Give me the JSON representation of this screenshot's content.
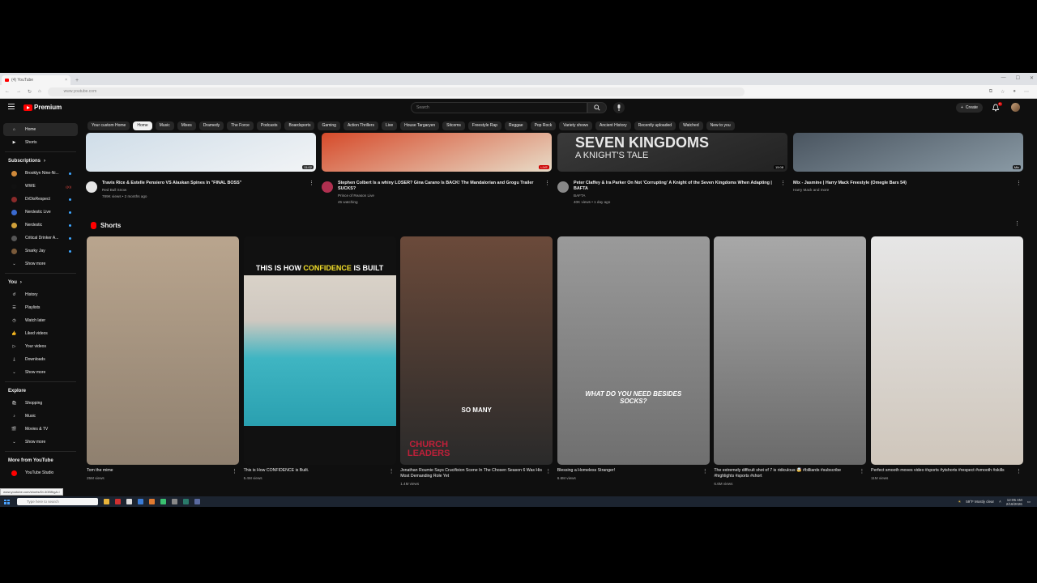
{
  "browser": {
    "tab_title": "(4) YouTube",
    "url": "www.youtube.com",
    "status_url": "www.youtube.com/shorts/DI-3OBfhgA-I"
  },
  "masthead": {
    "logo_text": "Premium",
    "search_placeholder": "Search",
    "create_label": "Create",
    "notification_count": "9+"
  },
  "chips": [
    "Your custom Home",
    "Home",
    "Music",
    "Mixes",
    "Dramedy",
    "The Force",
    "Podcasts",
    "Boardsports",
    "Gaming",
    "Action Thrillers",
    "Live",
    "House Targaryen",
    "Sitcoms",
    "Freestyle Rap",
    "Reggae",
    "Pop Rock",
    "Variety shows",
    "Ancient History",
    "Recently uploaded",
    "Watched",
    "New to you"
  ],
  "sidebar": {
    "main": [
      {
        "label": "Home",
        "icon": "home-icon"
      },
      {
        "label": "Shorts",
        "icon": "shorts-icon"
      }
    ],
    "subscriptions_title": "Subscriptions",
    "subscriptions": [
      {
        "label": "Brooklyn Nine-Ni...",
        "color": "#d08a3a"
      },
      {
        "label": "WWE",
        "color": "#111111"
      },
      {
        "label": "DrDisRespect",
        "color": "#8a2a2a"
      },
      {
        "label": "Nerdestic Live",
        "color": "#3a6ad0"
      },
      {
        "label": "Nerdestic",
        "color": "#d0a03a"
      },
      {
        "label": "Critical Drinker A...",
        "color": "#555555"
      },
      {
        "label": "Snarky Jay",
        "color": "#7a5a3a"
      }
    ],
    "show_more": "Show more",
    "you_title": "You",
    "you_items": [
      {
        "label": "History",
        "icon": "history-icon"
      },
      {
        "label": "Playlists",
        "icon": "playlists-icon"
      },
      {
        "label": "Watch later",
        "icon": "watch-later-icon"
      },
      {
        "label": "Liked videos",
        "icon": "liked-icon"
      },
      {
        "label": "Your videos",
        "icon": "your-videos-icon"
      },
      {
        "label": "Downloads",
        "icon": "downloads-icon"
      }
    ],
    "explore_title": "Explore",
    "explore_items": [
      {
        "label": "Shopping",
        "icon": "shopping-icon"
      },
      {
        "label": "Music",
        "icon": "music-icon"
      },
      {
        "label": "Movies & TV",
        "icon": "movies-icon"
      }
    ],
    "more_title": "More from YouTube",
    "studio_label": "YouTube Studio"
  },
  "videos": [
    {
      "title": "Travis Rice & Estelle Pensiero VS Alaskan Spines In \"FINAL BOSS\"",
      "channel": "Red Bull Snow",
      "meta": "789K views • 2 months ago",
      "duration": "11:02",
      "thumb_a": "#cfdde8",
      "thumb_b": "#f2f4f6",
      "avatar": "#e6e6e6"
    },
    {
      "title": "Stephen Colbert Is a whiny LOSER? Gina Carano Is BACK! The Mandalorian and Grogu Trailer SUCKS?",
      "channel": "Prince of Reason Live",
      "meta": "45 watching",
      "duration": "LIVE",
      "thumb_a": "#d64a2a",
      "thumb_b": "#e8dcc8",
      "avatar": "#b03050"
    },
    {
      "title": "Peter Claffey & Ira Parker On Not 'Corrupting' A Knight of the Seven Kingdoms When Adapting | BAFTA",
      "channel": "BAFTA",
      "meta": "40K views • 1 day ago",
      "duration": "15:08",
      "thumb_a": "#3a3a3a",
      "thumb_b": "#222222",
      "avatar": "#888888",
      "overlay1": "SEVEN KINGDOMS",
      "overlay2": "A KNIGHT'S TALE"
    },
    {
      "title": "Mix - Jasmine | Harry Mack Freestyle (Omegle Bars 54)",
      "channel": "Harry Mack and more",
      "meta": "",
      "duration": "Mix",
      "thumb_a": "#4a5560",
      "thumb_b": "#8a9aa5",
      "avatar": ""
    }
  ],
  "shorts_title": "Shorts",
  "shorts": [
    {
      "title": "Tom the mime",
      "views": "25M views",
      "bg_a": "#b9a58e",
      "bg_b": "#8f806f",
      "overlay": ""
    },
    {
      "title": "This is How CONFIDENCE is Built.",
      "views": "5.4M views",
      "bg_a": "#3fb5c2",
      "bg_b": "#111111",
      "overlay": "THIS IS HOW CONFIDENCE IS BUILT",
      "overlay_pre": "THIS IS HOW",
      "overlay_hl": "CONFIDENCE",
      "overlay_post": "IS BUILT"
    },
    {
      "title": "Jonathan Roumie Says Crucifixion Scene In The Chosen Season 6 Was His Most Demanding Role Yet",
      "views": "1.4M views",
      "bg_a": "#6b4a3a",
      "bg_b": "#2a2a2a",
      "overlay": "SO MANY",
      "brand": "CHURCH LEADERS"
    },
    {
      "title": "Blessing a Homeless Stranger!",
      "views": "6.6M views",
      "bg_a": "#9a9a9a",
      "bg_b": "#6f6f6f",
      "overlay": "WHAT DO YOU NEED BESIDES SOCKS?"
    },
    {
      "title": "The extremely difficult shot of 7 is ridiculous 🤯 #billiards #subscribe #highlights #sports #short",
      "views": "6.6M views",
      "bg_a": "#a8a8a8",
      "bg_b": "#6a6a6a",
      "overlay": ""
    },
    {
      "title": "Perfect smooth moves video #sports #ytshorts #respect #smooth #skills",
      "views": "11M views",
      "bg_a": "#e6e6e6",
      "bg_b": "#cfc6bb",
      "overlay": ""
    }
  ],
  "taskbar": {
    "search_placeholder": "Type here to search",
    "weather": "59°F Mostly clear",
    "time": "12:05 AM",
    "date": "2/18/2026"
  }
}
